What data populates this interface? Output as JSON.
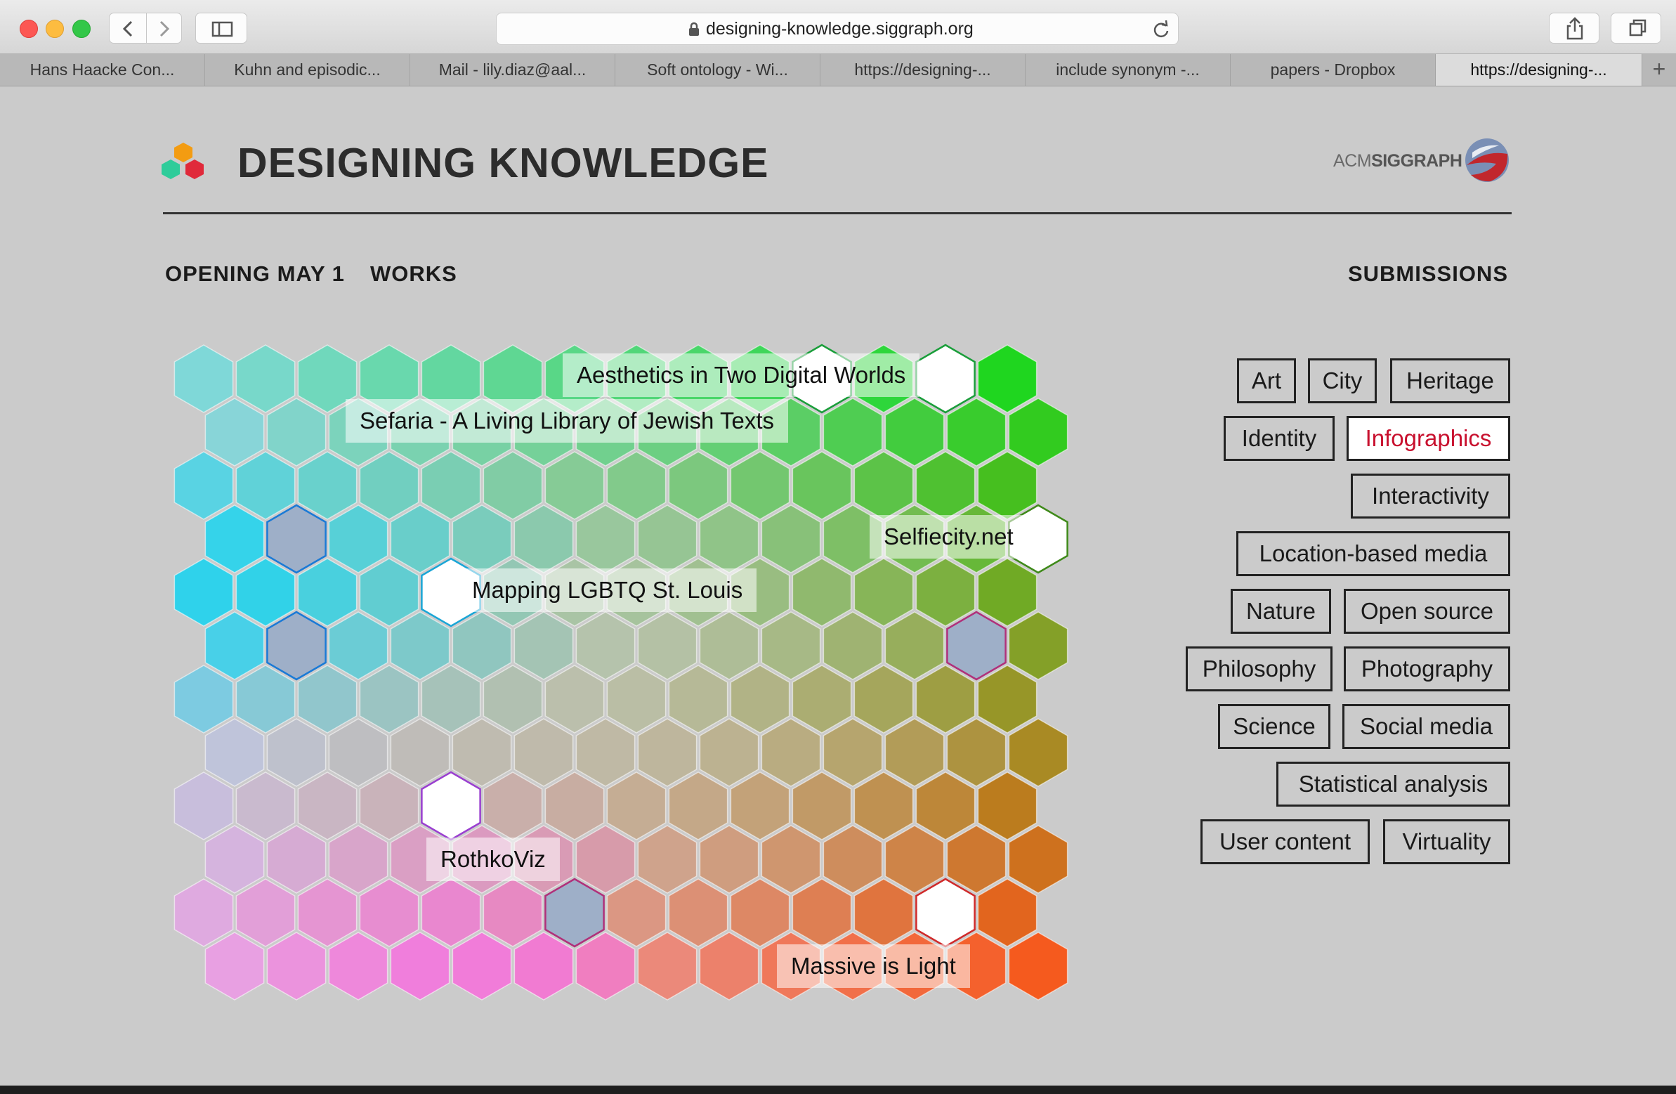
{
  "browser": {
    "url": "designing-knowledge.siggraph.org",
    "tabs": [
      {
        "label": "Hans Haacke Con...",
        "active": false
      },
      {
        "label": "Kuhn and episodic...",
        "active": false
      },
      {
        "label": "Mail - lily.diaz@aal...",
        "active": false
      },
      {
        "label": "Soft ontology - Wi...",
        "active": false
      },
      {
        "label": "https://designing-...",
        "active": false
      },
      {
        "label": "include synonym -...",
        "active": false
      },
      {
        "label": "papers - Dropbox",
        "active": false
      },
      {
        "label": "https://designing-...",
        "active": true
      }
    ],
    "new_tab_label": "+"
  },
  "site": {
    "title": "DESIGNING KNOWLEDGE",
    "sponsor_prefix": "ACM",
    "sponsor_name": "SIGGRAPH",
    "logo_colors": [
      "#f39c12",
      "#2ecc9a",
      "#e0293a"
    ]
  },
  "nav": {
    "opening": "OPENING MAY 1",
    "works": "WORKS",
    "submissions": "SUBMISSIONS"
  },
  "map": {
    "works": [
      {
        "title": "Aesthetics in Two Digital Worlds",
        "accent": "#1a9e3a"
      },
      {
        "title": "Sefaria - A Living Library of Jewish Texts",
        "accent": "#2aa6c8"
      },
      {
        "title": "Selfiecity.net",
        "accent": "#3f8a1a"
      },
      {
        "title": "Mapping LGBTQ St. Louis",
        "accent": "#1aa6d6"
      },
      {
        "title": "RothkoViz",
        "accent": "#9a3fd0"
      },
      {
        "title": "Massive is Light",
        "accent": "#d02a2a"
      }
    ]
  },
  "tags": [
    {
      "label": "Art",
      "active": false
    },
    {
      "label": "City",
      "active": false
    },
    {
      "label": "Heritage",
      "active": false
    },
    {
      "label": "Identity",
      "active": false
    },
    {
      "label": "Infographics",
      "active": true
    },
    {
      "label": "Interactivity",
      "active": false
    },
    {
      "label": "Location-based media",
      "active": false
    },
    {
      "label": "Nature",
      "active": false
    },
    {
      "label": "Open source",
      "active": false
    },
    {
      "label": "Philosophy",
      "active": false
    },
    {
      "label": "Photography",
      "active": false
    },
    {
      "label": "Science",
      "active": false
    },
    {
      "label": "Social media",
      "active": false
    },
    {
      "label": "Statistical analysis",
      "active": false
    },
    {
      "label": "User content",
      "active": false
    },
    {
      "label": "Virtuality",
      "active": false
    }
  ],
  "colors": {
    "page_bg": "#cbcbcb",
    "active_tag_text": "#c8102e",
    "corner_top_left": "#7fd8d8",
    "corner_top_right": "#1fd61f",
    "corner_bottom_left": "#e2b8dc",
    "corner_bottom_right": "#f55a1e"
  }
}
